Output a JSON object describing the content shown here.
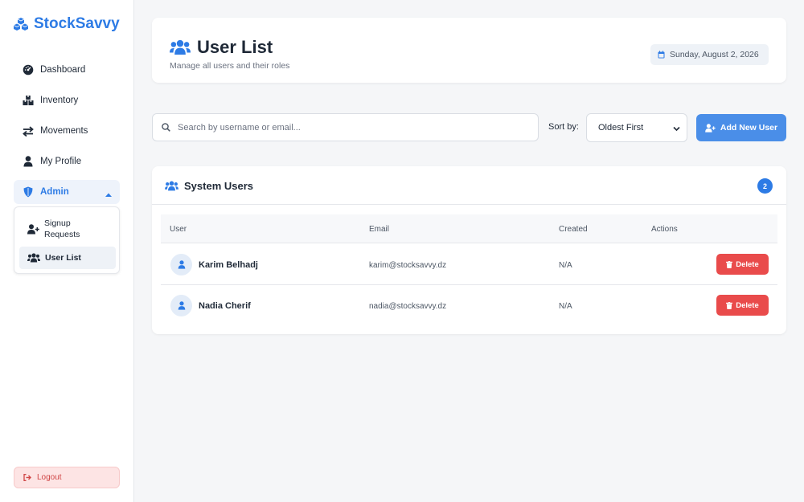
{
  "brand": {
    "name": "StockSavvy"
  },
  "sidebar": {
    "items": [
      {
        "label": "Dashboard",
        "icon": "dashboard-icon"
      },
      {
        "label": "Inventory",
        "icon": "inventory-icon"
      },
      {
        "label": "Movements",
        "icon": "arrows-exchange-icon"
      },
      {
        "label": "My Profile",
        "icon": "user-icon"
      }
    ],
    "admin": {
      "label": "Admin",
      "icon": "shield-icon",
      "expanded": true,
      "submenu": [
        {
          "label": "Signup Requests",
          "icon": "user-plus-icon"
        },
        {
          "label": "User List",
          "icon": "users-icon",
          "active": true
        }
      ]
    },
    "logout_label": "Logout"
  },
  "header": {
    "title": "User List",
    "subtitle": "Manage all users and their roles",
    "date": "Sunday, August 2, 2026"
  },
  "toolbar": {
    "search_placeholder": "Search by username or email...",
    "search_value": "",
    "sort_label": "Sort by:",
    "sort_value": "Oldest First",
    "add_button_label": "Add New User"
  },
  "users_table": {
    "title": "System Users",
    "count": "2",
    "columns": [
      "User",
      "Email",
      "Created",
      "Actions"
    ],
    "rows": [
      {
        "name": "Karim Belhadj",
        "email": "karim@stocksavvy.dz",
        "created": "N/A",
        "action": "Delete"
      },
      {
        "name": "Nadia Cherif",
        "email": "nadia@stocksavvy.dz",
        "created": "N/A",
        "action": "Delete"
      }
    ]
  },
  "colors": {
    "accent": "#2d7be5",
    "button_primary": "#4a8ee8",
    "danger": "#e94b4b",
    "logout_bg": "#fde4e4",
    "logout_text": "#d04646"
  }
}
